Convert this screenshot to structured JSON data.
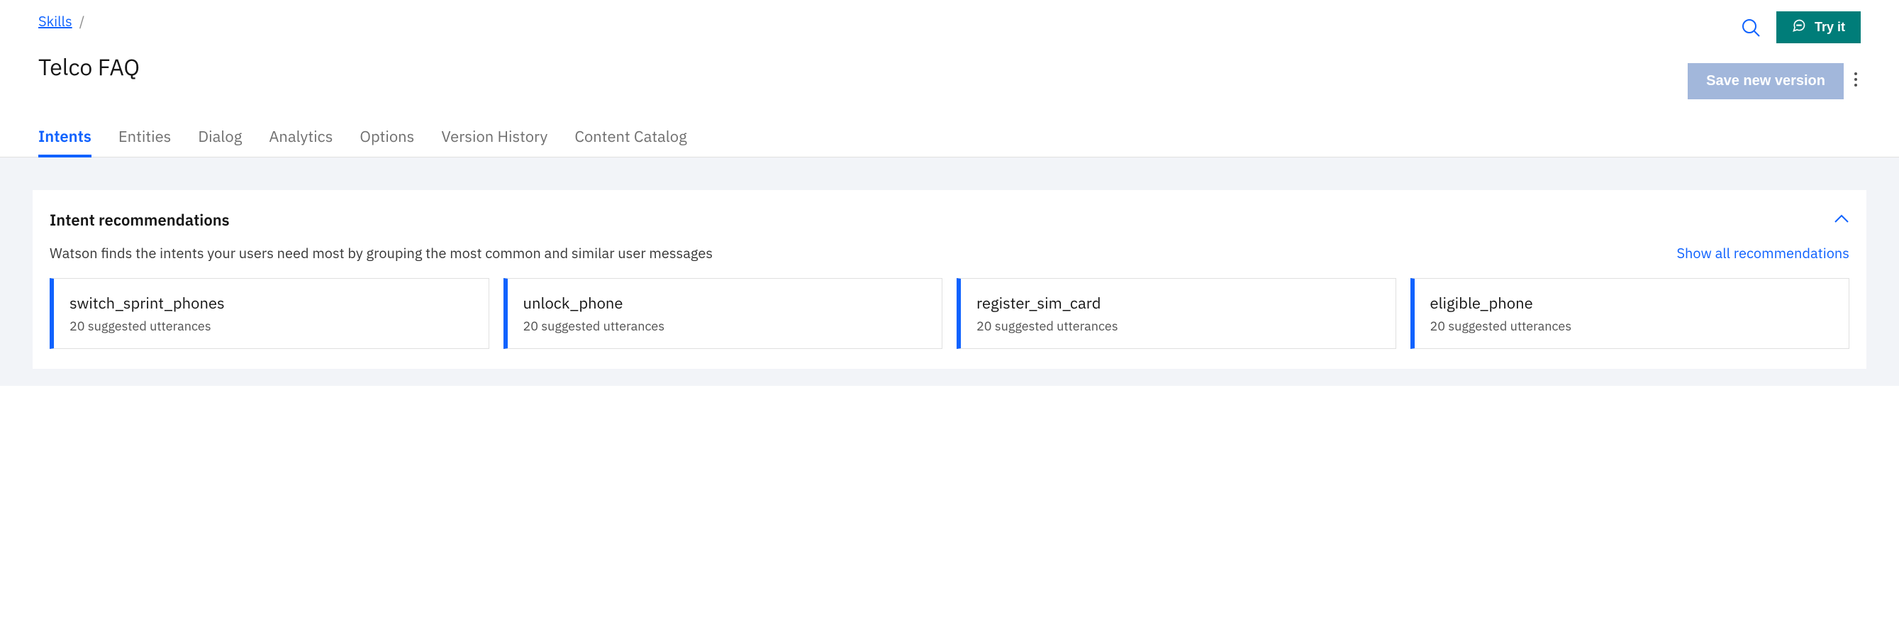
{
  "breadcrumb": {
    "root": "Skills",
    "separator": "/"
  },
  "page_title": "Telco FAQ",
  "actions": {
    "try_it": "Try it",
    "save_version": "Save new version"
  },
  "tabs": [
    {
      "id": "intents",
      "label": "Intents",
      "active": true
    },
    {
      "id": "entities",
      "label": "Entities",
      "active": false
    },
    {
      "id": "dialog",
      "label": "Dialog",
      "active": false
    },
    {
      "id": "analytics",
      "label": "Analytics",
      "active": false
    },
    {
      "id": "options",
      "label": "Options",
      "active": false
    },
    {
      "id": "version-history",
      "label": "Version History",
      "active": false
    },
    {
      "id": "content-catalog",
      "label": "Content Catalog",
      "active": false
    }
  ],
  "recommendations": {
    "title": "Intent recommendations",
    "description": "Watson finds the intents your users need most by grouping the most common and similar user messages",
    "show_all": "Show all recommendations",
    "cards": [
      {
        "name": "switch_sprint_phones",
        "sub": "20 suggested utterances"
      },
      {
        "name": "unlock_phone",
        "sub": "20 suggested utterances"
      },
      {
        "name": "register_sim_card",
        "sub": "20 suggested utterances"
      },
      {
        "name": "eligible_phone",
        "sub": "20 suggested utterances"
      }
    ]
  }
}
